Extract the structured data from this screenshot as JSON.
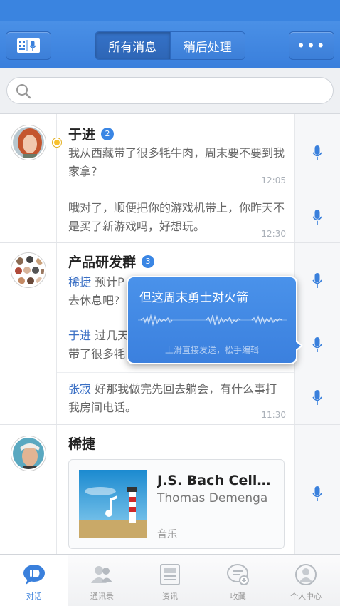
{
  "header": {
    "segments": [
      {
        "label": "所有消息",
        "active": true
      },
      {
        "label": "稍后处理",
        "active": false
      }
    ],
    "more_label": "•••"
  },
  "search": {
    "placeholder": ""
  },
  "conversations": [
    {
      "name": "于进",
      "badge": "2",
      "messages": [
        {
          "text": "我从西藏带了很多牦牛肉，周末要不要到我家拿？",
          "time": "12:05"
        },
        {
          "text": "哦对了，顺便把你的游戏机带上，你昨天不是买了新游戏吗，好想玩。",
          "time": "12:30"
        }
      ]
    },
    {
      "name": "产品研发群",
      "badge": "3",
      "messages": [
        {
          "sender": "稀捷",
          "text": " 预计P",
          "text2": "去休息吧?",
          "time": ""
        },
        {
          "sender": "于进",
          "text": " 过几天",
          "text2": "带了很多牦",
          "time": ""
        },
        {
          "sender": "张寂",
          "text": " 好那我做完先回去躺会，有什么事打我房间电话。",
          "time": "11:30"
        }
      ]
    },
    {
      "name": "稀捷",
      "music": {
        "title": "J.S. Bach Cello Suites",
        "artist": "Thomas Demenga",
        "type": "音乐"
      }
    }
  ],
  "voice_popup": {
    "text": "但这周末勇士对火箭",
    "hint": "上滑直接发送，松手编辑"
  },
  "tabs": [
    {
      "label": "对话",
      "icon": "chat-bubble-icon",
      "active": true
    },
    {
      "label": "通讯录",
      "icon": "contacts-icon",
      "active": false
    },
    {
      "label": "资讯",
      "icon": "news-icon",
      "active": false
    },
    {
      "label": "收藏",
      "icon": "favorites-icon",
      "active": false
    },
    {
      "label": "个人中心",
      "icon": "profile-icon",
      "active": false
    }
  ],
  "colors": {
    "accent": "#3a80dc",
    "header": "#4a90e6",
    "badge": "#3a86e4",
    "sender": "#3a6fc4"
  }
}
